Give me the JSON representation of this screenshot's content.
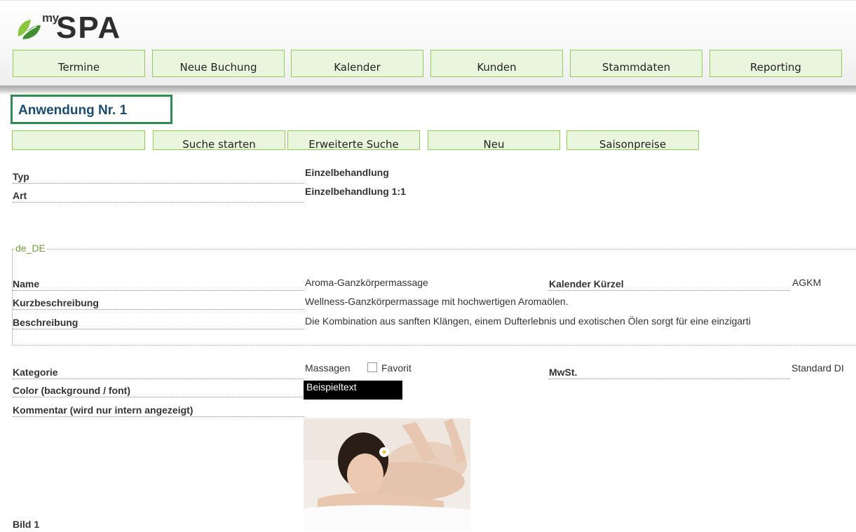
{
  "logo": {
    "my": "my",
    "spa": "SPA"
  },
  "nav": [
    "Termine",
    "Neue Buchung",
    "Kalender",
    "Kunden",
    "Stammdaten",
    "Reporting"
  ],
  "page_title": "Anwendung Nr. 1",
  "toolbar": {
    "search_value": "",
    "buttons": [
      "Suche starten",
      "Erweiterte Suche",
      "Neu",
      "Saisonpreise"
    ]
  },
  "fields": {
    "typ": {
      "label": "Typ",
      "value": "Einzelbehandlung"
    },
    "art": {
      "label": "Art",
      "value": "Einzelbehandlung 1:1"
    }
  },
  "locale": {
    "legend": "de_DE",
    "name": {
      "label": "Name",
      "value": "Aroma-Ganzkörpermassage"
    },
    "kalender_kuerzel": {
      "label": "Kalender Kürzel",
      "value": "AGKM"
    },
    "kurzbeschreibung": {
      "label": "Kurzbeschreibung",
      "value": "Wellness-Ganzkörpermassage mit hochwertigen Aromaölen."
    },
    "beschreibung": {
      "label": "Beschreibung",
      "value": "Die Kombination aus sanften Klängen, einem Dufterlebnis und exotischen Ölen sorgt für eine einzigarti"
    }
  },
  "details": {
    "kategorie": {
      "label": "Kategorie",
      "value": "Massagen",
      "favorit_label": "Favorit",
      "favorit_checked": false
    },
    "mwst": {
      "label": "MwSt.",
      "value": "Standard DI"
    },
    "color": {
      "label": "Color (background / font)",
      "sample": "Beispieltext",
      "background": "#000000",
      "font": "#ffffff"
    },
    "kommentar": {
      "label": "Kommentar (wird nur intern angezeigt)",
      "value": ""
    },
    "bild": {
      "label": "Bild 1"
    }
  },
  "colors": {
    "button_bg": "#e9f6dd",
    "button_border": "#8fce55",
    "title_border": "#2f8b52",
    "title_text": "#1c4c70",
    "legend_text": "#6fa33b"
  }
}
